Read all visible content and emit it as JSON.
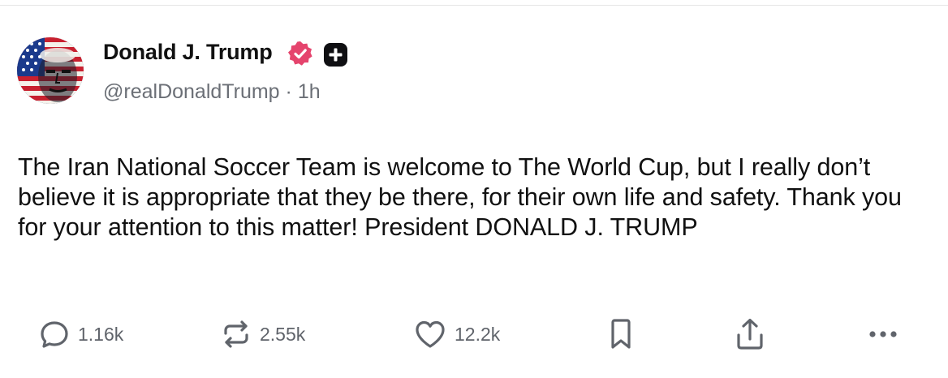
{
  "post": {
    "author": {
      "name": "Donald J. Trump",
      "handle": "@realDonaldTrump",
      "time": "1h",
      "separator": "·",
      "verified": true,
      "badge_icon": "plus-badge-icon",
      "verified_icon": "verified-badge-icon"
    },
    "text": "The Iran National Soccer Team is welcome to The World Cup, but I really don’t believe it is appropriate that they be there, for their own life and safety. Thank you for your attention to this matter! President DONALD J. TRUMP",
    "actions": {
      "reply": {
        "icon": "reply-icon",
        "count": "1.16k"
      },
      "repost": {
        "icon": "repost-icon",
        "count": "2.55k"
      },
      "like": {
        "icon": "heart-icon",
        "count": "12.2k"
      },
      "bookmark": {
        "icon": "bookmark-icon"
      },
      "share": {
        "icon": "share-icon"
      },
      "more": {
        "icon": "more-icon"
      }
    }
  },
  "colors": {
    "verified": "#e5446d",
    "text": "#111111",
    "muted": "#6b6f76",
    "icon": "#60646b"
  }
}
